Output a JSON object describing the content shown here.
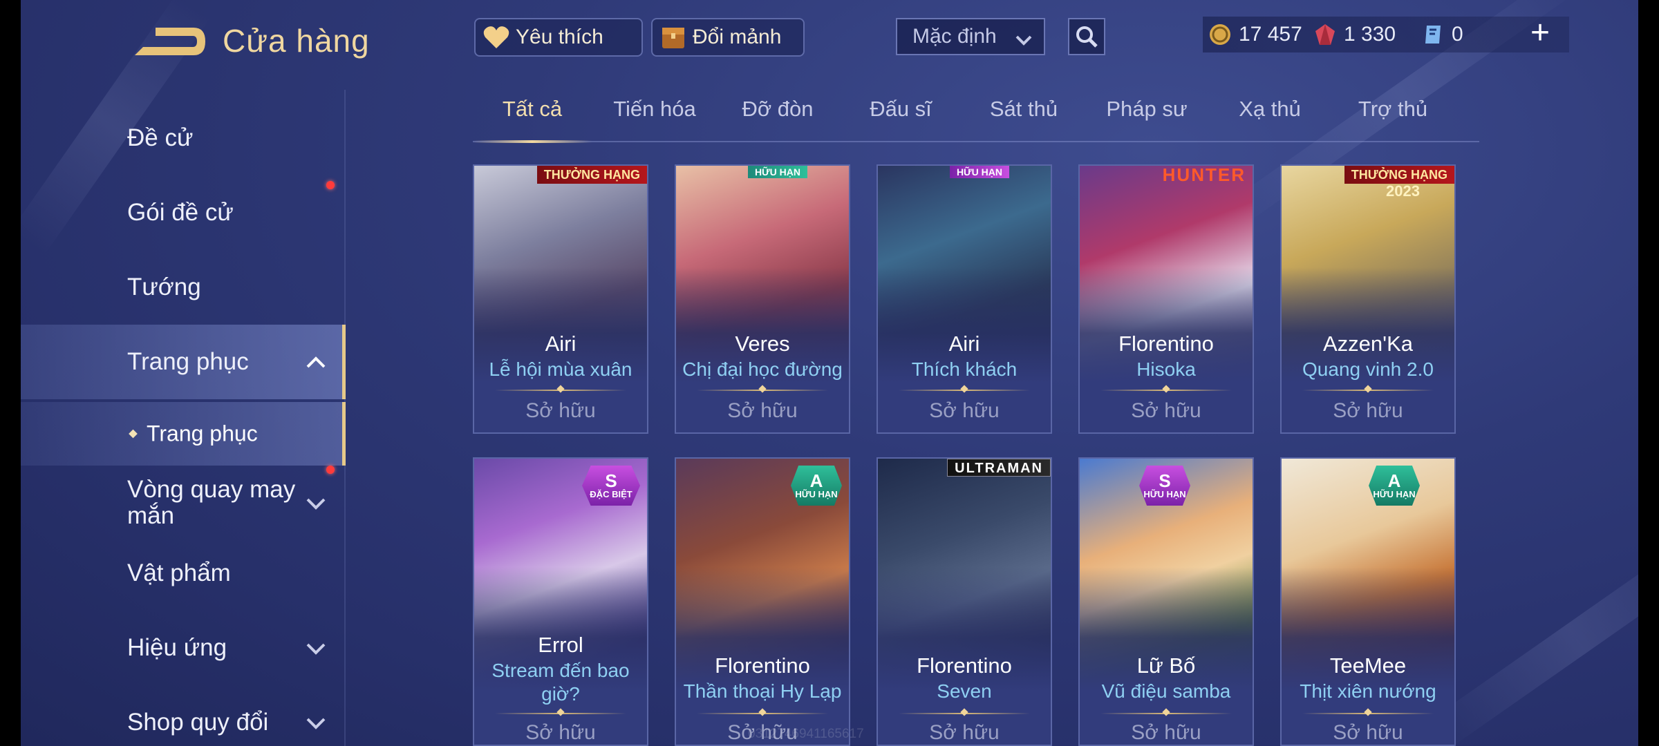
{
  "header": {
    "title": "Cửa hàng",
    "favorites_label": "Yêu thích",
    "exchange_label": "Đổi mảnh",
    "sort_value": "Mặc định",
    "currencies": [
      {
        "icon": "gold-coin-icon",
        "value": "17 457"
      },
      {
        "icon": "ruby-gem-icon",
        "value": "1 330"
      },
      {
        "icon": "voucher-icon",
        "value": "0"
      }
    ]
  },
  "sidebar": {
    "items": [
      {
        "label": "Đề cử"
      },
      {
        "label": "Gói đề cử"
      },
      {
        "label": "Tướng"
      },
      {
        "label": "Trang phục"
      },
      {
        "label": "Trang phục"
      },
      {
        "label": "Vòng quay may mắn"
      },
      {
        "label": "Vật phẩm"
      },
      {
        "label": "Hiệu ứng"
      },
      {
        "label": "Shop quy đổi"
      }
    ]
  },
  "tabs": [
    "Tất cả",
    "Tiến hóa",
    "Đỡ đòn",
    "Đấu sĩ",
    "Sát thủ",
    "Pháp sư",
    "Xạ thủ",
    "Trợ thủ"
  ],
  "colors": {
    "accent_gold": "#f3dfae",
    "skin_name": "#8fd0f2",
    "background": "#2f3a78",
    "notification_dot": "#ff3b3b"
  },
  "cards": [
    {
      "hero": "Airi",
      "skin": "Lễ hội mùa xuân",
      "status": "Sở hữu",
      "tag": "THƯỞNG HẠNG"
    },
    {
      "hero": "Veres",
      "skin": "Chị đại học đường",
      "status": "Sở hữu",
      "tag": "HỮU HẠN"
    },
    {
      "hero": "Airi",
      "skin": "Thích khách",
      "status": "Sở hữu",
      "tag": "HỮU HẠN"
    },
    {
      "hero": "Florentino",
      "skin": "Hisoka",
      "status": "Sở hữu",
      "tag": "HUNTER"
    },
    {
      "hero": "Azzen'Ka",
      "skin": "Quang vinh 2.0",
      "status": "Sở hữu",
      "tag": "THƯỞNG HẠNG",
      "tag2": "2023"
    },
    {
      "hero": "Errol",
      "skin": "Stream đến bao giờ?",
      "status": "Sở hữu",
      "rank": "S",
      "rank_sub": "ĐẶC BIỆT"
    },
    {
      "hero": "Florentino",
      "skin": "Thần thoại Hy Lạp",
      "status": "Sở hữu",
      "rank": "A",
      "rank_sub": "HỮU HẠN"
    },
    {
      "hero": "Florentino",
      "skin": "Seven",
      "status": "Sở hữu",
      "tag": "ULTRAMAN"
    },
    {
      "hero": "Lữ Bố",
      "skin": "Vũ điệu samba",
      "status": "Sở hữu",
      "rank": "S",
      "rank_sub": "HỮU HẠN"
    },
    {
      "hero": "TeeMee",
      "skin": "Thịt xiên nướng",
      "status": "Sở hữu",
      "rank": "A",
      "rank_sub": "HỮU HẠN"
    }
  ],
  "watermark": "0312746941165617"
}
